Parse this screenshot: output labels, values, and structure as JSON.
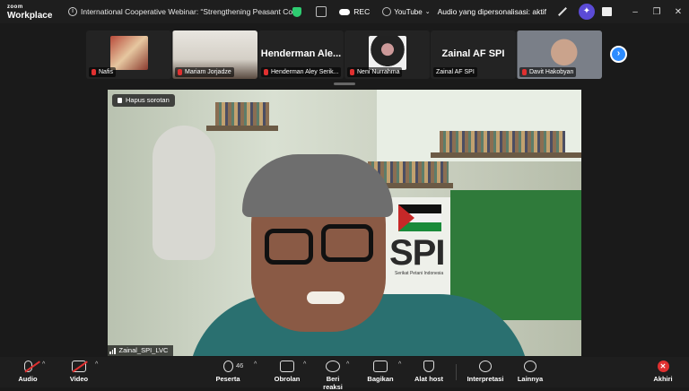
{
  "app": {
    "logo_top": "zoom",
    "logo_bottom": "Workplace"
  },
  "meeting": {
    "title": "International Cooperative Webinar: “Strengthening Peasant Cooperatives"
  },
  "titlebar": {
    "rec_label": "REC",
    "youtube_label": "YouTube",
    "personalization_label": "Audio yang dipersonalisasi: aktif",
    "minimize": "–",
    "restore": "❐",
    "close": "✕"
  },
  "gallery": {
    "tiles": [
      {
        "name": "Nafis",
        "muted": true
      },
      {
        "name": "Mariam Jorjadze",
        "muted": true
      },
      {
        "name": "Henderman Aley Serik...",
        "display_name": "Henderman Ale...",
        "muted": true
      },
      {
        "name": "Neni Nurrahma",
        "muted": true
      },
      {
        "name": "Zainal AF SPI",
        "display_name": "Zainal AF SPI",
        "muted": false
      },
      {
        "name": "Davit Hakobyan",
        "muted": true
      }
    ],
    "next_label": "›"
  },
  "spotlight": {
    "remove_label": "Hapus sorotan",
    "speaker_name": "Zainal_SPI_LVC",
    "banner_text": "SPI",
    "banner_subtext": "Serikat Petani Indonesia"
  },
  "toolbar": {
    "audio": "Audio",
    "video": "Video",
    "participants": "Peserta",
    "participants_count": "46",
    "chat": "Obrolan",
    "reactions": "Beri reaksi",
    "share": "Bagikan",
    "host_tools": "Alat host",
    "interpretation": "Interpretasi",
    "more": "Lainnya",
    "end": "Akhiri"
  },
  "colors": {
    "accent": "#2d8cff",
    "end": "#e03030",
    "secure": "#2ecc71"
  }
}
